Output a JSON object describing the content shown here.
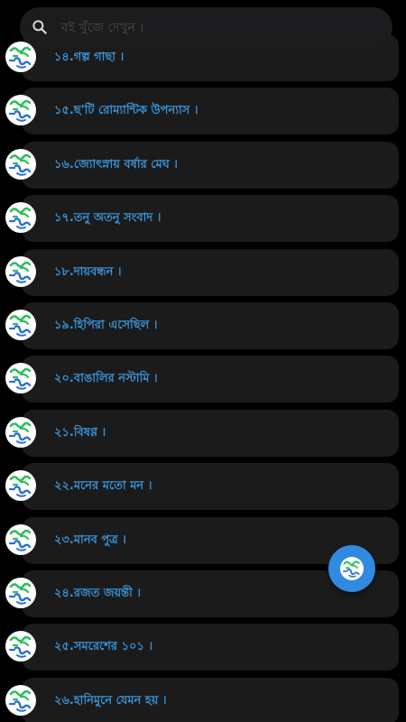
{
  "search": {
    "placeholder": "বই খুঁজে দেখুন ।"
  },
  "items": [
    {
      "label": "১৪.গল্প গাছা ।"
    },
    {
      "label": "১৫.ছ'টি রোম্যান্টিক উপন্যাস ।"
    },
    {
      "label": "১৬.জ্যোৎস্নায় বর্ষার মেঘ ।"
    },
    {
      "label": "১৭.তনু অতনু সংবাদ ।"
    },
    {
      "label": "১৮.দায়বন্ধন ।"
    },
    {
      "label": "১৯.হিপিরা এসেছিল ।"
    },
    {
      "label": "২০.বাঙালির নস্টামি ।"
    },
    {
      "label": "২১.বিষণ্ণ ।"
    },
    {
      "label": "২২.মনের মতো মন ।"
    },
    {
      "label": "২৩.মানব পুত্র ।"
    },
    {
      "label": "২৪.রজত জয়ন্তী ।"
    },
    {
      "label": "২৫.সমরেশের ১০১ ।"
    },
    {
      "label": "২৬.হানিমুনে যেমন হয় ।"
    }
  ],
  "logo_icon": "boi-tong-logo-icon",
  "colors": {
    "background": "#000000",
    "card": "#1b1b1b",
    "title": "#3a93d8",
    "fab": "#2f8ae0",
    "logo_green": "#2bbf5a",
    "logo_blue": "#2a6fd6"
  }
}
